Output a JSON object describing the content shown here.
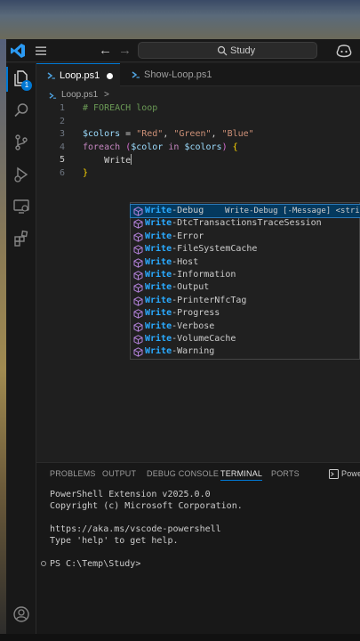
{
  "window": {
    "search_text": "Study"
  },
  "tabs": [
    {
      "label": "Loop.ps1",
      "active": true,
      "dirty": true
    },
    {
      "label": "Show-Loop.ps1",
      "active": false,
      "dirty": false
    }
  ],
  "activity_badge": "1",
  "breadcrumb": {
    "file": "Loop.ps1",
    "sep": ">"
  },
  "editor": {
    "line_numbers": [
      "1",
      "2",
      "3",
      "4",
      "5",
      "6"
    ],
    "current_line": "5",
    "line1": {
      "comment": "# FOREACH loop"
    },
    "line3": {
      "var": "$colors",
      "eq": " = ",
      "s1": "\"Red\"",
      "c1": ", ",
      "s2": "\"Green\"",
      "c2": ", ",
      "s3": "\"Blue\""
    },
    "line4": {
      "kw": "foreach",
      "sp": " ",
      "open": "(",
      "var1": "$color",
      "in": " in ",
      "var2": "$colors",
      "close": ")",
      "sp2": " ",
      "brace": "{"
    },
    "line5": {
      "indent": "    ",
      "typed": "Write"
    },
    "line6": {
      "brace": "}"
    }
  },
  "suggest": {
    "prefix": "Write",
    "items": [
      {
        "rest": "-Debug",
        "detail": "Write-Debug [-Message] <string>",
        "selected": true
      },
      {
        "rest": "-DtcTransactionsTraceSession",
        "detail": ""
      },
      {
        "rest": "-Error",
        "detail": ""
      },
      {
        "rest": "-FileSystemCache",
        "detail": ""
      },
      {
        "rest": "-Host",
        "detail": ""
      },
      {
        "rest": "-Information",
        "detail": ""
      },
      {
        "rest": "-Output",
        "detail": ""
      },
      {
        "rest": "-PrinterNfcTag",
        "detail": ""
      },
      {
        "rest": "-Progress",
        "detail": ""
      },
      {
        "rest": "-Verbose",
        "detail": ""
      },
      {
        "rest": "-VolumeCache",
        "detail": ""
      },
      {
        "rest": "-Warning",
        "detail": ""
      }
    ]
  },
  "panel": {
    "tabs": [
      "PROBLEMS",
      "OUTPUT",
      "DEBUG CONSOLE",
      "TERMINAL",
      "PORTS"
    ],
    "active_tab": "TERMINAL",
    "shell_label": "Powe"
  },
  "terminal": {
    "lines": [
      "PowerShell Extension v2025.0.0",
      "Copyright (c) Microsoft Corporation.",
      "",
      "https://aka.ms/vscode-powershell",
      "Type 'help' to get help.",
      "",
      "PS C:\\Temp\\Study>"
    ]
  },
  "colors": {
    "accent": "#0078d4",
    "editor_bg": "#1f1f1f",
    "chrome_bg": "#181818",
    "suggest_selected": "#04395e",
    "match_highlight": "#2aaaff"
  }
}
